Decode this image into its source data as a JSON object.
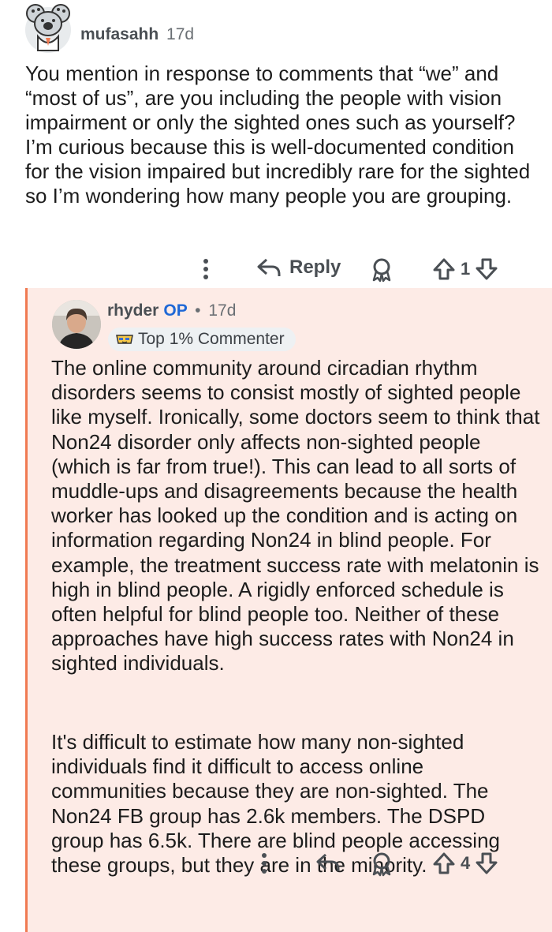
{
  "parent_comment": {
    "username": "mufasahh",
    "age": "17d",
    "body": "You mention in response to comments that “we” and “most of us”, are you including the people with vision impairment or only the sighted ones such as yourself? I’m curious because this is well-documented condition for the vision impaired but incredibly rare for the sighted so I’m wondering how many people you are grouping.",
    "actions": {
      "reply_label": "Reply",
      "vote_count": "1"
    }
  },
  "reply_comment": {
    "username": "rhyder",
    "op_label": "OP",
    "separator": "•",
    "age": "17d",
    "badge": "Top 1% Commenter",
    "paragraphs": [
      "The online community around circadian rhythm disorders seems to consist mostly of sighted people like myself. Ironically, some doctors seem to think that Non24 disorder only affects non-sighted people (which is far from true!). This can lead to all sorts of muddle-ups and disagreements because the health worker has looked up the condition and is acting on information regarding Non24 in blind people. For example, the treatment success rate with melatonin is high in blind people. A rigidly enforced schedule is often helpful for blind people too. Neither of these approaches have high success rates with Non24 in sighted individuals.",
      "It's difficult to estimate how many non-sighted individuals find it difficult to access online communities because they are non-sighted. The Non24 FB group has 2.6k members. The DSPD group has 6.5k. There are blind people accessing these groups, but they are in the minority."
    ],
    "actions": {
      "vote_count": "4"
    }
  },
  "colors": {
    "thread_line": "#f07a52",
    "reply_bg": "#fdebe6",
    "op": "#1f68d6"
  }
}
